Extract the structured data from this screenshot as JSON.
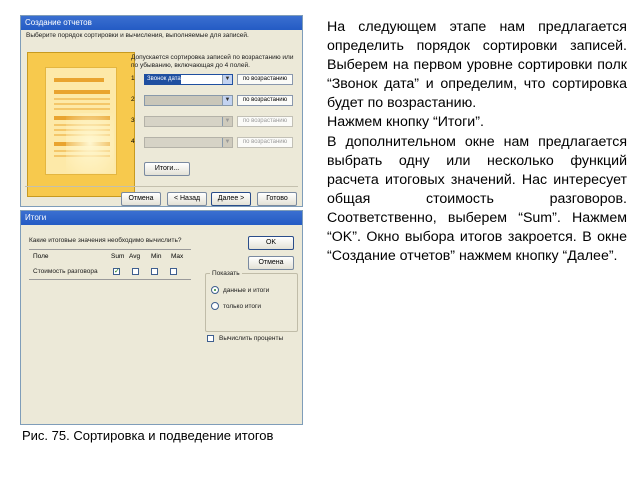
{
  "dialog_sort": {
    "title": "Создание отчетов",
    "instruction": "Выберите порядок сортировки и вычисления, выполняемые для записей.",
    "hint": "Допускается сортировка записей по возрастанию или по убыванию, включающая до 4 полей.",
    "rows": [
      {
        "num": "1",
        "field": "Звонок дата",
        "order": "по возрастанию",
        "enabled": true
      },
      {
        "num": "2",
        "field": "",
        "order": "по возрастанию",
        "enabled": true
      },
      {
        "num": "3",
        "field": "",
        "order": "по возрастанию",
        "enabled": false
      },
      {
        "num": "4",
        "field": "",
        "order": "по возрастанию",
        "enabled": false
      }
    ],
    "totals_button": "Итоги...",
    "buttons": {
      "cancel": "Отмена",
      "back": "< Назад",
      "next": "Далее >",
      "finish": "Готово"
    }
  },
  "dialog_totals": {
    "title": "Итоги",
    "question": "Какие итоговые значения необходимо вычислить?",
    "columns": {
      "field": "Поле",
      "sum": "Sum",
      "avg": "Avg",
      "min": "Min",
      "max": "Max"
    },
    "rows": [
      {
        "field": "Стоимость разговора",
        "sum": true,
        "avg": false,
        "min": false,
        "max": false
      }
    ],
    "ok": "OK",
    "cancel": "Отмена",
    "show_group": {
      "label": "Показать",
      "options": [
        "данные и итоги",
        "только итоги"
      ],
      "selected": 0
    },
    "percent_label": "Вычислить проценты"
  },
  "text": {
    "p1": "На следующем этапе нам предлагается определить порядок сортировки записей. Выберем на первом уровне сортировки полк “Звонок дата” и определим, что сортировка будет по возрастанию.",
    "p2": "Нажмем кнопку “Итоги”.",
    "p3": "В дополнительном окне нам предлагается выбрать одну или несколько функций расчета итоговых значений. Нас интересует общая стоимость разговоров. Соответственно, выберем “Sum”. Нажмем “OK”. Окно выбора итогов закроется. В окне “Создание отчетов” нажмем кнопку “Далее”."
  },
  "caption": "Рис. 75. Сортировка и подведение итогов"
}
